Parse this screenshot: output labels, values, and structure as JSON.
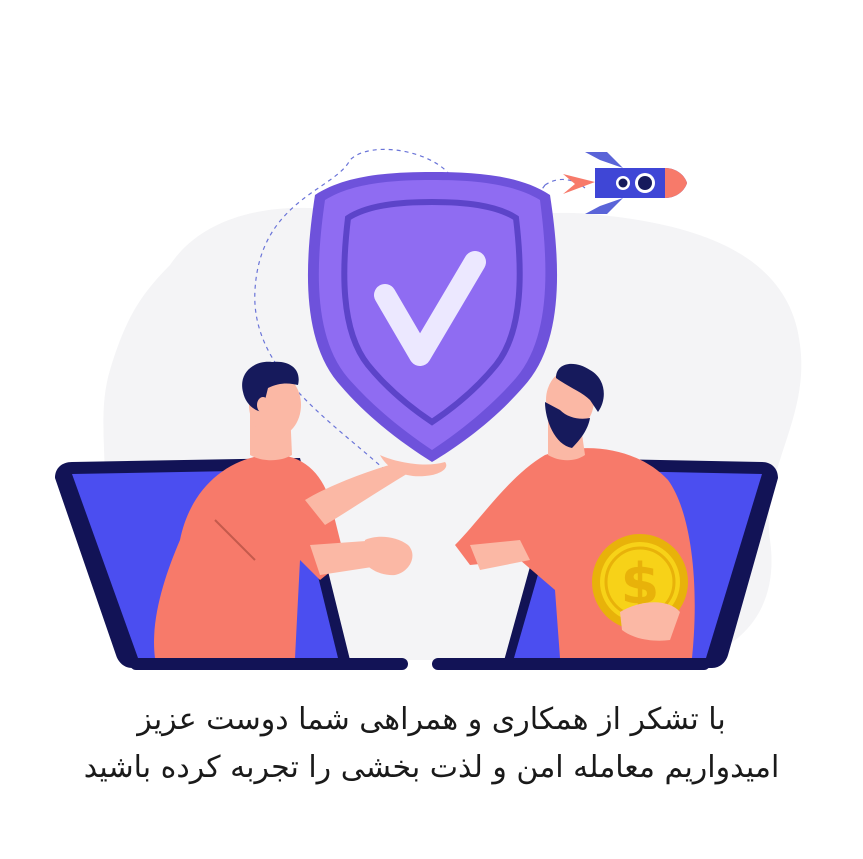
{
  "message": {
    "line1": "با تشکر از  همکاری و همراهی شما دوست عزیز",
    "line2": "امیدواریم معامله امن و لذت بخشی را تجربه کرده باشید"
  },
  "icons": {
    "shield": "shield-check-icon",
    "rocket": "rocket-icon",
    "coin": "dollar-coin-icon"
  },
  "colors": {
    "shield": "#8f6cf2",
    "laptop_screen": "#4b4ef0",
    "laptop_frame": "#121356",
    "shirt": "#f77a6a",
    "skin": "#fbb8a5",
    "hair": "#161a5c",
    "coin": "#f7d218",
    "blob": "#f4f4f6"
  }
}
